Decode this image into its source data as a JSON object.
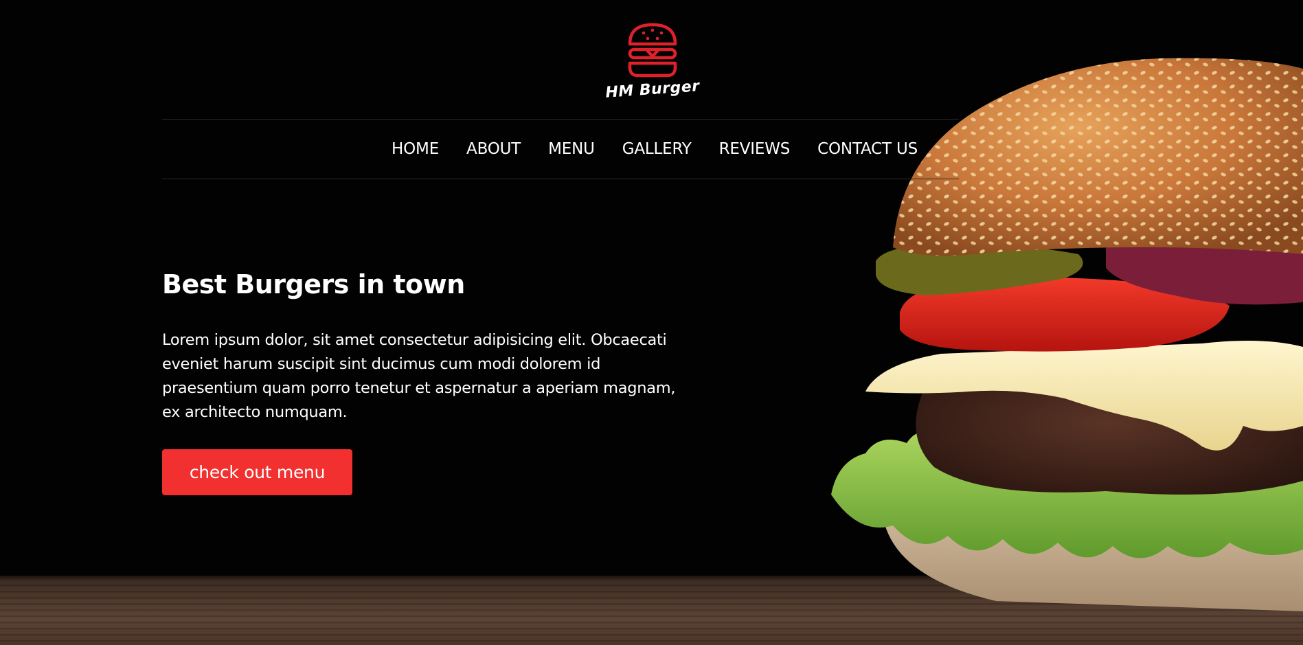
{
  "brand": {
    "name": "HM Burger",
    "accent_color": "#e0202b",
    "logo_icon": "burger-icon"
  },
  "nav": {
    "items": [
      {
        "label": "HOME"
      },
      {
        "label": "ABOUT"
      },
      {
        "label": "MENU"
      },
      {
        "label": "GALLERY"
      },
      {
        "label": "REVIEWS"
      },
      {
        "label": "CONTACT US"
      }
    ]
  },
  "hero": {
    "title": "Best Burgers in town",
    "text": "Lorem ipsum dolor, sit amet consectetur adipisicing elit. Obcaecati eveniet harum suscipit sint ducimus cum modi dolorem id praesentium quam porro tenetur et aspernatur a aperiam magnam, ex architecto numquam.",
    "button_label": "check out menu",
    "button_color": "#f1302f",
    "image": "burger-photo"
  }
}
